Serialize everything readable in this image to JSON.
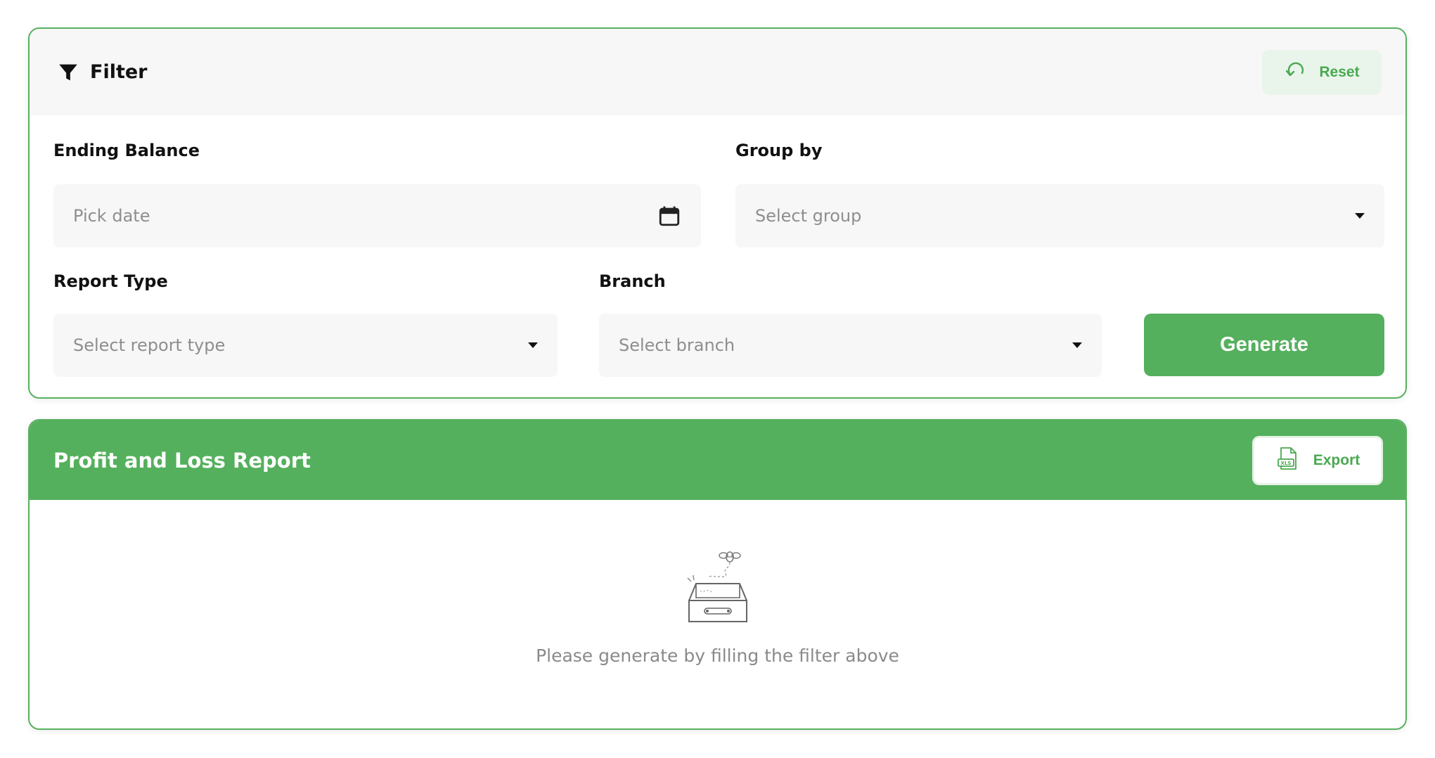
{
  "filter": {
    "title": "Filter",
    "reset_label": "Reset",
    "ending_balance": {
      "label": "Ending Balance",
      "placeholder": "Pick date"
    },
    "group_by": {
      "label": "Group by",
      "placeholder": "Select group"
    },
    "report_type": {
      "label": "Report Type",
      "placeholder": "Select report type"
    },
    "branch": {
      "label": "Branch",
      "placeholder": "Select branch"
    },
    "generate_label": "Generate"
  },
  "report": {
    "title": "Profit and Loss Report",
    "export_label": "Export",
    "empty_message": "Please generate by filling the filter above"
  },
  "icons": {
    "filter": "funnel-icon",
    "reset": "undo-icon",
    "date": "calendar-icon",
    "dropdown": "caret-down-icon",
    "export": "xls-file-icon",
    "empty": "empty-box-bee-icon"
  },
  "colors": {
    "accent": "#54b05c",
    "accent_light": "#e9f5ea",
    "field_bg": "#f7f7f7",
    "placeholder": "#8e8e8e"
  }
}
